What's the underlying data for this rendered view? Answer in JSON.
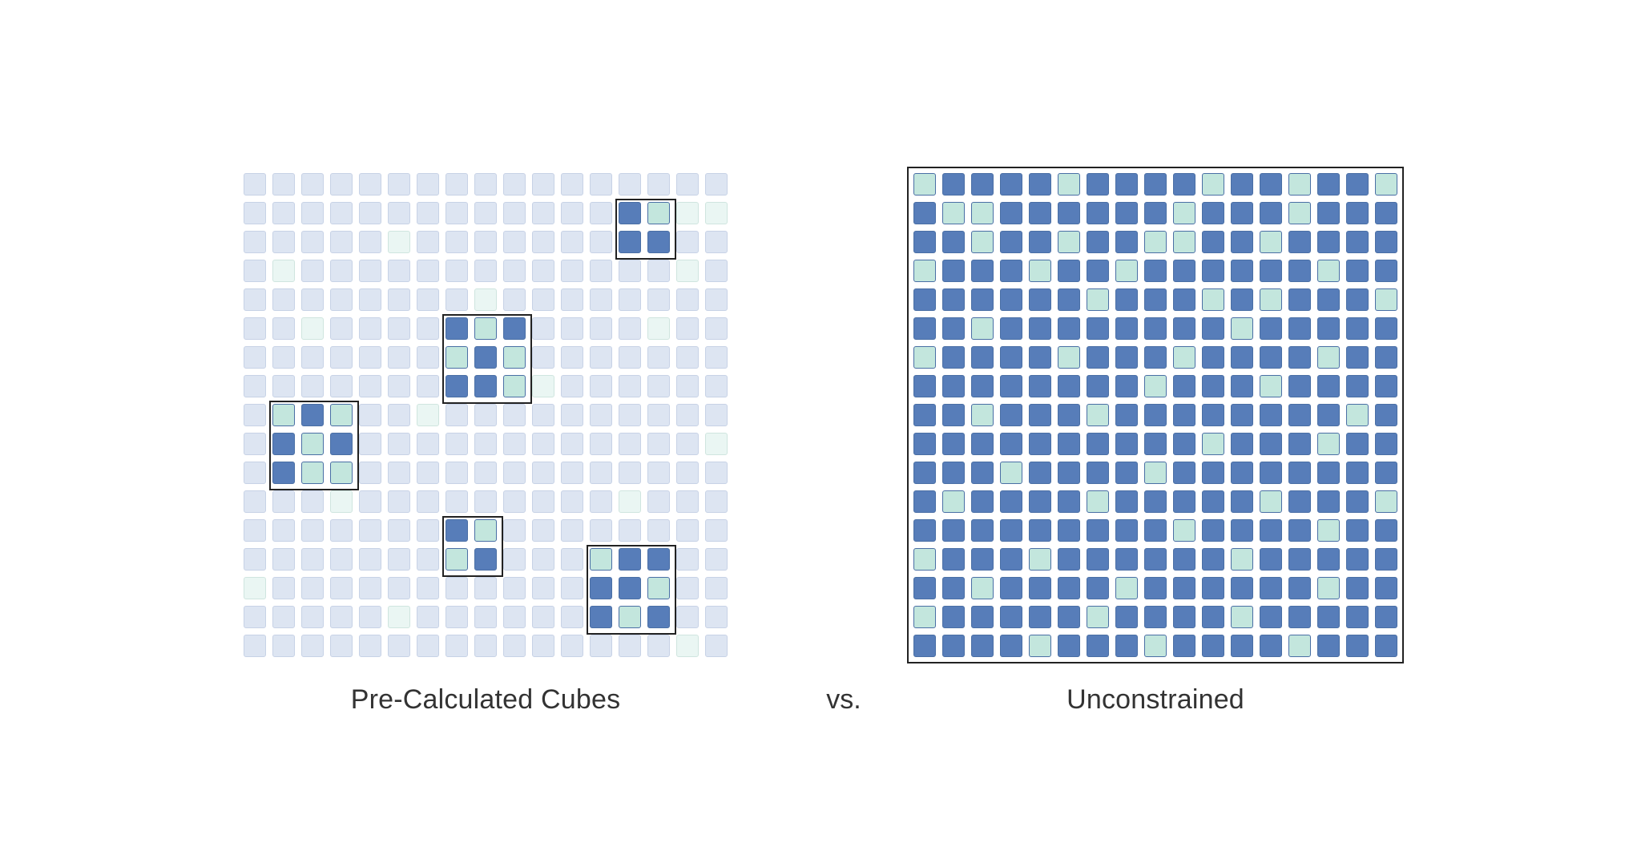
{
  "labels": {
    "left": "Pre-Calculated Cubes",
    "right": "Unconstrained",
    "vs": "vs."
  },
  "colors": {
    "dark": "#577db9",
    "light": "#c3e6dd",
    "bgBlue": "#dde5f2",
    "bgTeal": "#eaf6f3",
    "cellBorder": "#4a6fa5",
    "bgCellBorder": "#c7d2e6",
    "bgCellBorderTeal": "#cfe5df"
  },
  "layout": {
    "cols": 17,
    "rows": 17,
    "cellSize": 28,
    "gap": 8
  },
  "leftBackground": [
    "bbbbbbbbbbbbbbbbb",
    "bbbbbbbbbbbbbbbtt",
    "bbbbbtbbbbbbbbbbb",
    "btbbbbbbbbbbbbbtb",
    "bbbbbbbbtbbbbbbbb",
    "bbtbbbbbbbbbbbtbb",
    "bbbbbbbbbbbbbbbbb",
    "bbbbbbbbbbtbbbbbb",
    "bbbbbbtbbbbbbbbbb",
    "btbbbbbbbbbbbbbbt",
    "bbbbbbbbbbbbbbbbb",
    "bbbtbbbbbbbbbtbbb",
    "bbbbbbbbbbbbbbbbb",
    "bbbbbbbbbbbbbbbbb",
    "tbbbbbbbbbbbbbbbb",
    "bbbbbtbbbbbbbbbbb",
    "bbbbbbbbbbbbbbbtb"
  ],
  "cubes": [
    {
      "r": 1,
      "c": 13,
      "w": 2,
      "h": 2,
      "cells": [
        "DL",
        "DD"
      ]
    },
    {
      "r": 5,
      "c": 7,
      "w": 3,
      "h": 3,
      "cells": [
        "DLD",
        "LDL",
        "DDL"
      ]
    },
    {
      "r": 8,
      "c": 1,
      "w": 3,
      "h": 3,
      "cells": [
        "LDL",
        "DLD",
        "DLL"
      ]
    },
    {
      "r": 12,
      "c": 7,
      "w": 2,
      "h": 2,
      "cells": [
        "DL",
        "LD"
      ]
    },
    {
      "r": 13,
      "c": 12,
      "w": 3,
      "h": 3,
      "cells": [
        "LDD",
        "DDL",
        "DLD"
      ]
    }
  ],
  "rightGrid": [
    "LDDDDLDDDDLDDLDDL",
    "DLLDDDDDDLDDDLDDD",
    "DDLDDLDDLLDDLDDDD",
    "LDDDLDDLDDDDDDLDD",
    "DDDDDDLDDDLDLDDDL",
    "DDLDDDDDDDDLDDDDD",
    "LDDDDLDDDLDDDDLDD",
    "DDDDDDDDLDDDLDDDD",
    "DDLDDDLDDDDDDDDLD",
    "DDDDDDDDDDLDDDLDD",
    "DDDLDDDDLDDDDDDDD",
    "DLDDDDLDDDDDLDDDL",
    "DDDDDDDDDLDDDDLDD",
    "LDDDLDDDDDDLDDDDD",
    "DDLDDDDLDDDDDDLDD",
    "LDDDDDLDDDDLDDDDD",
    "DDDDLDDDLDDDDLDDD"
  ]
}
